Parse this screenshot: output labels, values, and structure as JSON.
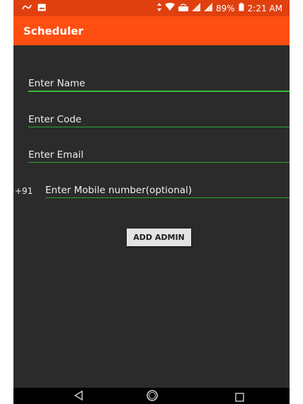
{
  "status_bar": {
    "left_icons": [
      "notification-icon",
      "image-icon"
    ],
    "battery_percent": "89%",
    "time": "2:21 AM"
  },
  "app_bar": {
    "title": "Scheduler"
  },
  "form": {
    "name_placeholder": "Enter Name",
    "code_placeholder": "Enter Code",
    "email_placeholder": "Enter Email",
    "mobile_prefix": "+91",
    "mobile_placeholder": "Enter Mobile number(optional)",
    "submit_label": "ADD ADMIN"
  },
  "nav_bar": {
    "icons": [
      "back-icon",
      "home-icon",
      "recents-icon"
    ]
  },
  "colors": {
    "status_bar": "#e0400f",
    "app_bar": "#ff4e12",
    "background": "#2b2b2b",
    "underline": "#2aa52a"
  }
}
